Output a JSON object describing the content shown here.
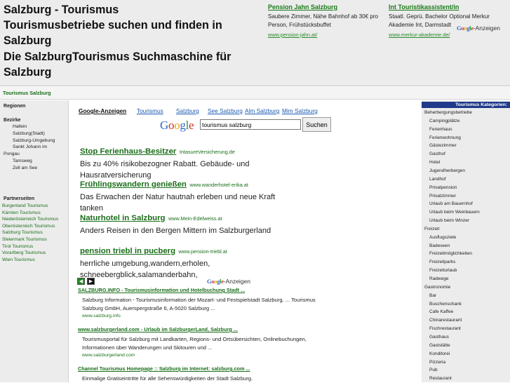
{
  "header": {
    "title_lines": [
      "Salzburg - Tourismus",
      "Tourismusbetriebe suchen und finden in",
      "Salzburg",
      "Die SalzburgTourismus Suchmaschine für",
      "Salzburg"
    ],
    "ads": [
      {
        "title": "Pension Jahn Salzburg",
        "desc": "Saubere Zimmer, Nähe Bahnhof ab 30€ pro Person, Frühstücksbuffet",
        "url": "www.pension-jahn.at/"
      },
      {
        "title": "Int Touristikassistent/in",
        "desc": "Staatl. Geprü. Bachelor Optional Merkur Akademie Int, Darmstadt",
        "url": "www.merkur-akademie.de/"
      }
    ],
    "google_ads_label": "-Anzeigen"
  },
  "breadcrumb": "Tourismus Salzburg",
  "left": {
    "regionen": "Regionen",
    "bezirke": "Bezirke",
    "bezirke_items": [
      {
        "label": "Hallein",
        "indent": true
      },
      {
        "label": "Salzburg(Stadt)",
        "indent": true
      },
      {
        "label": "Salzburg-Umgebung",
        "indent": true
      },
      {
        "label": "Sankt Johann im",
        "indent": true
      },
      {
        "label": "Pongau",
        "indent": false
      },
      {
        "label": "Tamsweg",
        "indent": true
      },
      {
        "label": "Zell am See",
        "indent": true
      }
    ],
    "partner_title": "Partnerseiten",
    "partners": [
      "Burgenland Tourismus",
      "Kärnten Tourismus",
      "Niederösterreich Tourismus",
      "Oberösterreich Tourismus",
      "Salzburg Tourismus",
      "Steiermark Tourismus",
      "Tirol Tourismus",
      "Vorarlberg Tourismus",
      "Wien Tourismus"
    ]
  },
  "main": {
    "google_ads_tab": "Google-Anzeigen",
    "sort_links": [
      "Tourismus",
      "Salzburg",
      "See Salzburg",
      "Alm Salzburg",
      "Mim Salzburg"
    ],
    "search_value": "tourismus salzburg",
    "search_button": "Suchen",
    "big_ads": [
      {
        "title": "Stop Ferienhaus-Besitzer",
        "url": "IntasureVersicherung.de",
        "desc": "Bis zu 40% risikobezogner Rabatt. Gebäude- und Hausratversicherung"
      },
      {
        "title": "Frühlingswandern genießen",
        "url": "www.wanderhotel-erika.at",
        "desc": "Das Erwachen der Natur hautnah erleben und neue Kraft tanken"
      },
      {
        "title": "Naturhotel in Salzburg",
        "url": "www.Mein-Edelweiss.at",
        "desc": "Anders Reisen in den Bergen Mittern im Salzburgerland"
      },
      {
        "title": "pension triebl in pucberg",
        "url": "www.pension-triebl.at",
        "desc": "herrliche umgebung,wandern,erholen, schneebergblick,salamanderbahn,"
      }
    ],
    "nav_prev": "◀",
    "nav_next": "▶",
    "results": [
      {
        "title": "SALZBURG.INFO - Tourismusinformation und Hotelbuchung Stadt ...",
        "desc": "Salzburg Information - Tourismusinformation der Mozart- und Festspielstadt Salzburg. ... Tourismus Salzburg GmbH, Auerspergstraße 6, A-5020 Salzburg ...",
        "url": "www.salzburg.info"
      },
      {
        "title": "www.salzburgerland.com - Urlaub im SalzburgerLand, Salzburg ...",
        "desc": "Tourismusportal für Salzburg mit Landkarten, Regions- und Ortsübersichten, Onlinebuchungen, Informationen über Wanderungen und Skitouren und ...",
        "url": "www.salzburgerland.com"
      },
      {
        "title": "Channel Tourismus Homepage :: Salzburg im Internet: salzburg.com ...",
        "desc": "Einmalige Gratiseintritte für alle Sehenswürdigkeiten der Stadt Salzburg.",
        "url": ""
      }
    ]
  },
  "right": {
    "title": "Tourismus Kategorien:",
    "categories": [
      {
        "label": "Beherbergungsbetriebe",
        "sub": false
      },
      {
        "label": "Campingplätze",
        "sub": true
      },
      {
        "label": "Ferienhaus",
        "sub": true
      },
      {
        "label": "Ferienwohnung",
        "sub": true
      },
      {
        "label": "Gästezimmer",
        "sub": true
      },
      {
        "label": "Gasthof",
        "sub": true
      },
      {
        "label": "Hotel",
        "sub": true
      },
      {
        "label": "Jugendherbergen",
        "sub": true
      },
      {
        "label": "Landhof",
        "sub": true
      },
      {
        "label": "Privatpension",
        "sub": true
      },
      {
        "label": "Privatzimmer",
        "sub": true
      },
      {
        "label": "Urlaub am Bauernhof",
        "sub": true
      },
      {
        "label": "Urlaub beim Weinbauern",
        "sub": true
      },
      {
        "label": "Urlaub beim Winzer",
        "sub": true
      },
      {
        "label": "Freizeit",
        "sub": false
      },
      {
        "label": "Ausflugsziele",
        "sub": true
      },
      {
        "label": "Badeseen",
        "sub": true
      },
      {
        "label": "Freizeitmöglichkeiten",
        "sub": true
      },
      {
        "label": "Freizeitparks",
        "sub": true
      },
      {
        "label": "Freizeiturlaub",
        "sub": true
      },
      {
        "label": "Radwege",
        "sub": true
      },
      {
        "label": "Gastronomie",
        "sub": false
      },
      {
        "label": "Bar",
        "sub": true
      },
      {
        "label": "Buschenschank",
        "sub": true
      },
      {
        "label": "Cafe Kaffee",
        "sub": true
      },
      {
        "label": "Chinarestaurant",
        "sub": true
      },
      {
        "label": "Fischrestaurant",
        "sub": true
      },
      {
        "label": "Gasthaus",
        "sub": true
      },
      {
        "label": "Gaststätte",
        "sub": true
      },
      {
        "label": "Konditorei",
        "sub": true
      },
      {
        "label": "Pizzeria",
        "sub": true
      },
      {
        "label": "Pub",
        "sub": true
      },
      {
        "label": "Restaurant",
        "sub": true
      }
    ]
  },
  "colors": {
    "link_green": "#1a6e1a",
    "category_header": "#1f3a8a",
    "sort_link_blue": "#1a5ab0"
  },
  "icons": {
    "prev": "chevron-left-icon",
    "next": "chevron-right-icon",
    "google": "google-logo"
  }
}
